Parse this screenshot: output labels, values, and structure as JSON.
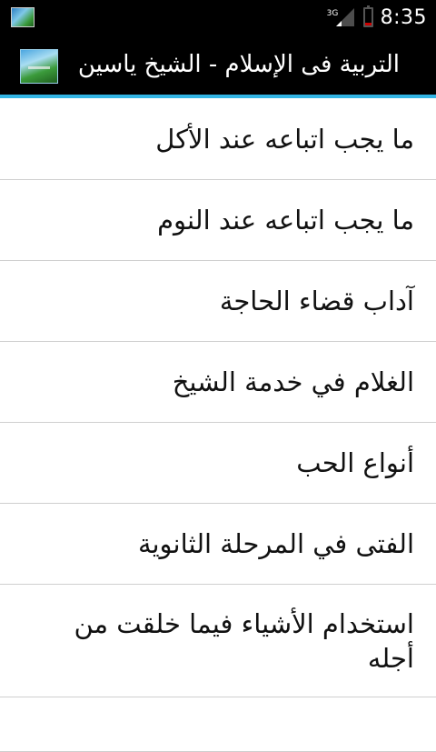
{
  "status_bar": {
    "time": "8:35",
    "network": "3G",
    "battery_level": 0.15,
    "battery_color": "#cc0000",
    "icons": [
      "notification-app-icon",
      "signal-icon",
      "battery-icon"
    ]
  },
  "action_bar": {
    "title": "التربية فى الإسلام - الشيخ ياسين",
    "accent_color": "#33b5e5",
    "icon": "app-icon"
  },
  "list": {
    "items": [
      {
        "label": "ما يجب اتباعه عند الأكل"
      },
      {
        "label": "ما يجب اتباعه عند النوم"
      },
      {
        "label": "آداب قضاء الحاجة"
      },
      {
        "label": "الغلام في خدمة الشيخ"
      },
      {
        "label": "أنواع الحب"
      },
      {
        "label": "الفتى في المرحلة الثانوية"
      },
      {
        "label": "استخدام الأشياء فيما خلقت من أجله"
      },
      {
        "label": ""
      }
    ]
  }
}
